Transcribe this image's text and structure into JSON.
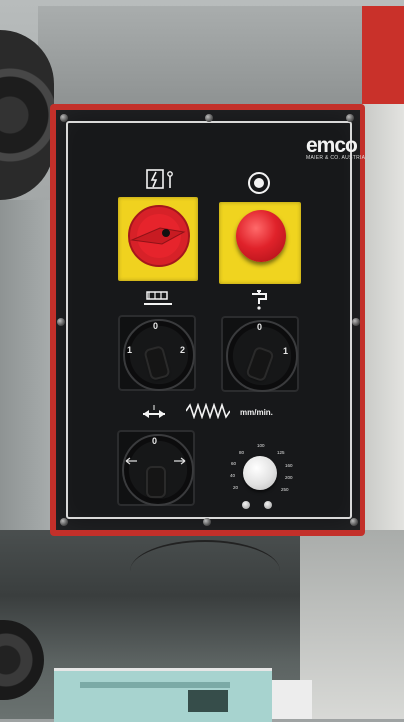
{
  "brand": {
    "logo_text": "emco",
    "subtitle": "MAIER & CO. AUSTRIA"
  },
  "main_switch": {
    "position_labels": [
      "0",
      "I"
    ]
  },
  "emergency_stop": {
    "color": "#e0222a"
  },
  "coolant_switch": {
    "position_labels": [
      "0",
      "1"
    ]
  },
  "spindle_switch": {
    "position_labels": [
      "1",
      "0",
      "2"
    ]
  },
  "feed_direction_switch": {
    "position_labels": [
      "0"
    ]
  },
  "feed_rate": {
    "units": "mm/min.",
    "scale": [
      "20",
      "40",
      "60",
      "80",
      "100",
      "125",
      "160",
      "200",
      "250"
    ]
  },
  "colors": {
    "panel": "#17181a",
    "frame": "#c3302a",
    "yellow": "#f0d21f"
  }
}
